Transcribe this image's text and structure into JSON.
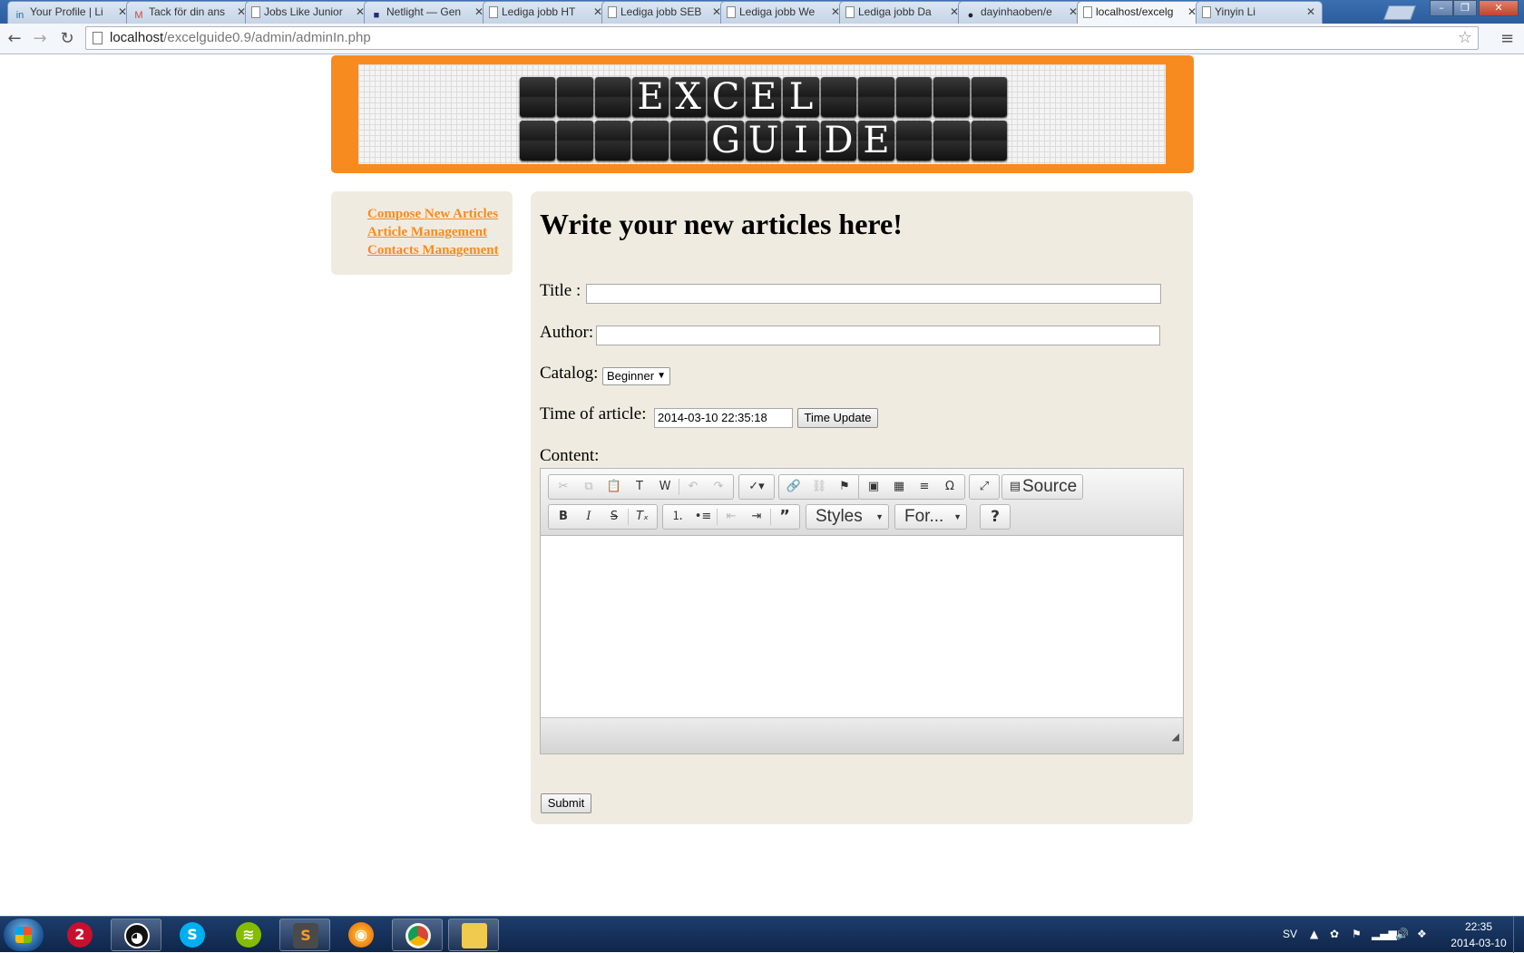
{
  "browser": {
    "tabs": [
      {
        "label": "Your Profile | Li",
        "icon": "in",
        "icon_color": "#0e76a8"
      },
      {
        "label": "Tack för din ans",
        "icon": "M",
        "icon_color": "#d14836"
      },
      {
        "label": "Jobs Like Junior",
        "icon": "",
        "icon_color": "#888888"
      },
      {
        "label": "Netlight — Gen",
        "icon": "■",
        "icon_color": "#2a2a6e"
      },
      {
        "label": "Lediga jobb HT",
        "icon": "",
        "icon_color": "#888888"
      },
      {
        "label": "Lediga jobb SEB",
        "icon": "",
        "icon_color": "#888888"
      },
      {
        "label": "Lediga jobb We",
        "icon": "",
        "icon_color": "#888888"
      },
      {
        "label": "Lediga jobb Da",
        "icon": "",
        "icon_color": "#888888"
      },
      {
        "label": "dayinhaoben/e",
        "icon": "●",
        "icon_color": "#222222"
      },
      {
        "label": "localhost/excelg",
        "icon": "",
        "icon_color": "#888888"
      },
      {
        "label": "Yinyin Li",
        "icon": "",
        "icon_color": "#888888"
      }
    ],
    "active_tab_index": 9,
    "url_host": "localhost",
    "url_path": "/excelguide0.9/admin/adminIn.php"
  },
  "banner": {
    "row1": [
      "",
      "",
      "",
      "E",
      "X",
      "C",
      "E",
      "L",
      "",
      "",
      "",
      "",
      ""
    ],
    "row2": [
      "",
      "",
      "",
      "",
      "",
      "G",
      "U",
      "I",
      "D",
      "E",
      "",
      "",
      ""
    ]
  },
  "sidebar": {
    "links": [
      "Compose New Articles",
      "Article Management",
      "Contacts Management"
    ],
    "link_color": "#f78b1f"
  },
  "form": {
    "heading": "Write your new articles here!",
    "title_label": "Title :",
    "title_value": "",
    "author_label": "Author:",
    "author_value": "",
    "catalog_label": "Catalog:",
    "catalog_selected": "Beginner",
    "time_label": "Time of article:",
    "time_value": "2014-03-10 22:35:18",
    "time_update_button": "Time Update",
    "content_label": "Content:",
    "submit_button": "Submit"
  },
  "editor": {
    "source_label": "Source",
    "styles_label": "Styles",
    "format_label": "For...",
    "help_label": "?"
  },
  "taskbar": {
    "language": "SV",
    "clock_time": "22:35",
    "clock_date": "2014-03-10"
  }
}
